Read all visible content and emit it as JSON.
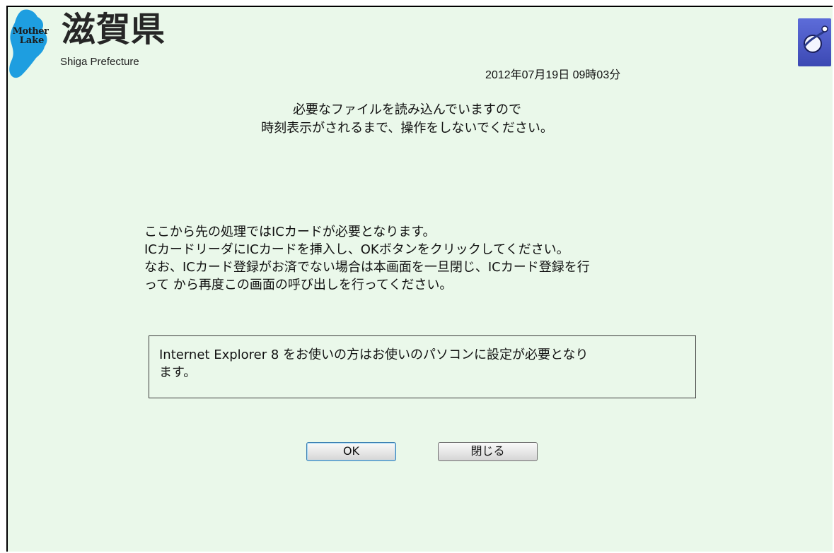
{
  "header": {
    "logo_word_1": "Mother",
    "logo_word_2": "Lake",
    "title": "滋賀県",
    "subtitle": "Shiga Prefecture",
    "app_icon": "browser-globe-icon"
  },
  "datetime": "2012年07月19日 09時03分",
  "notice": {
    "line1": "必要なファイルを読み込んでいますので",
    "line2": "時刻表示がされるまで、操作をしないでください。"
  },
  "ic_card": {
    "line1": "ここから先の処理ではICカードが必要となります。",
    "line2": "ICカードリーダにICカードを挿入し、OKボタンをクリックしてください。",
    "line3": "なお、ICカード登録がお済でない場合は本画面を一旦閉じ、ICカード登録を行",
    "line4": "って から再度この画面の呼び出しを行ってください。"
  },
  "ie_notice": {
    "line1": "Internet Explorer 8 をお使いの方はお使いのパソコンに設定が必要となり",
    "line2": "ます。"
  },
  "buttons": {
    "ok": "OK",
    "close": "閉じる"
  },
  "colors": {
    "background": "#eaf8ea",
    "logo_blue": "#1e9ee0",
    "icon_blue": "#4a57c4"
  }
}
